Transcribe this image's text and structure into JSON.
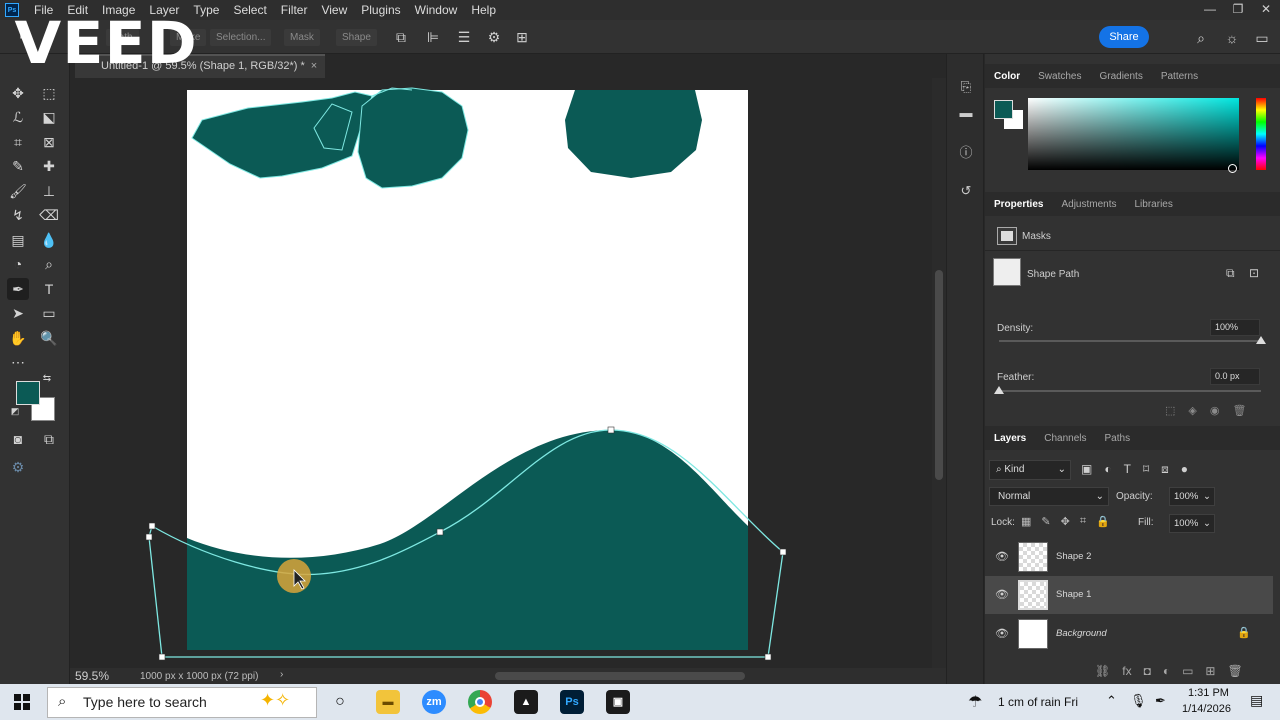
{
  "menubar": {
    "logo": "Ps",
    "items": [
      "File",
      "Edit",
      "Image",
      "Layer",
      "Type",
      "Select",
      "Filter",
      "View",
      "Plugins",
      "Window",
      "Help"
    ]
  },
  "watermark": "VEED",
  "options": {
    "mode_label": "Path",
    "make_label": "Make",
    "selection_label": "Selection...",
    "mask_label": "Mask",
    "shape_label": "Shape",
    "share_label": "Share"
  },
  "document": {
    "tab_title": "Untitled-1 @ 59.5% (Shape 1, RGB/32*) *",
    "zoom": "59.5%",
    "info": "1000 px x 1000 px (72 ppi)"
  },
  "colors": {
    "foreground": "#0b5a55",
    "background": "#ffffff",
    "path": "#7ee8e2",
    "accent": "#1473e6"
  },
  "color_panel": {
    "tabs": [
      "Color",
      "Swatches",
      "Gradients",
      "Patterns"
    ]
  },
  "properties_panel": {
    "tabs": [
      "Properties",
      "Adjustments",
      "Libraries"
    ],
    "masks_label": "Masks",
    "shape_path_label": "Shape Path",
    "density_label": "Density:",
    "density_value": "100%",
    "density_level": 1.0,
    "feather_label": "Feather:",
    "feather_value": "0.0 px"
  },
  "layers_panel": {
    "tabs": [
      "Layers",
      "Channels",
      "Paths"
    ],
    "filter_label": "Kind",
    "blend_mode": "Normal",
    "opacity_label": "Opacity:",
    "opacity_value": "100%",
    "lock_label": "Lock:",
    "fill_label": "Fill:",
    "fill_value": "100%",
    "layers": [
      {
        "name": "Shape 2",
        "selected": false
      },
      {
        "name": "Shape 1",
        "selected": true
      },
      {
        "name": "Background",
        "selected": false,
        "locked": true
      }
    ]
  },
  "taskbar": {
    "search_placeholder": "Type here to search",
    "weather": "1 cm of rain Fri",
    "time": "1:31 PM",
    "date": "1/14/2026",
    "apps": [
      "Cortana",
      "File Explorer",
      "Zoom",
      "Chrome",
      "Affinity",
      "Photoshop",
      "Capture"
    ],
    "zoom_label": "zm",
    "ps_label": "Ps"
  }
}
